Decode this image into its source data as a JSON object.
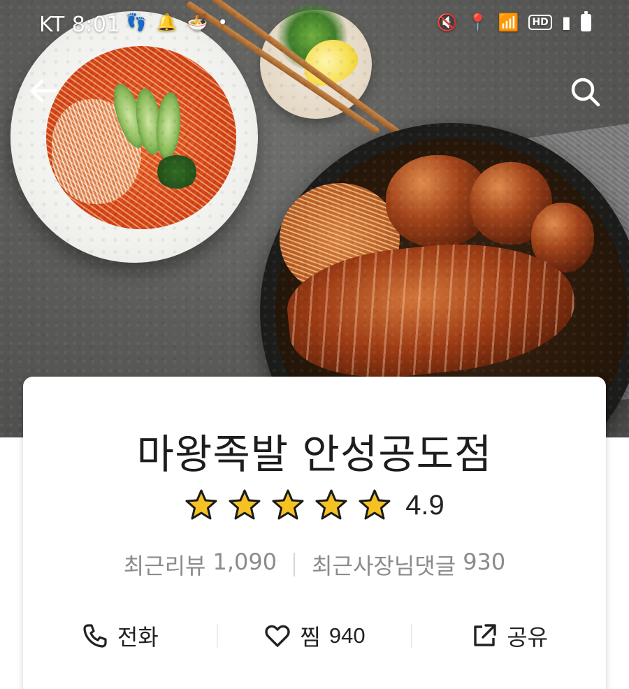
{
  "status_bar": {
    "carrier": "KT",
    "time": "8:01",
    "hd_badge": "HD"
  },
  "nav": {
    "back_icon": "arrow-left-icon",
    "search_icon": "search-icon"
  },
  "store": {
    "name": "마왕족발 안성공도점",
    "rating": "4.9",
    "rating_stars": 5,
    "star_color": "#F6C122",
    "recent_reviews_label": "최근리뷰",
    "recent_reviews_count": "1,090",
    "owner_replies_label": "최근사장님댓글",
    "owner_replies_count": "930"
  },
  "actions": {
    "call_label": "전화",
    "zzim_label": "찜",
    "zzim_count": "940",
    "share_label": "공유"
  }
}
